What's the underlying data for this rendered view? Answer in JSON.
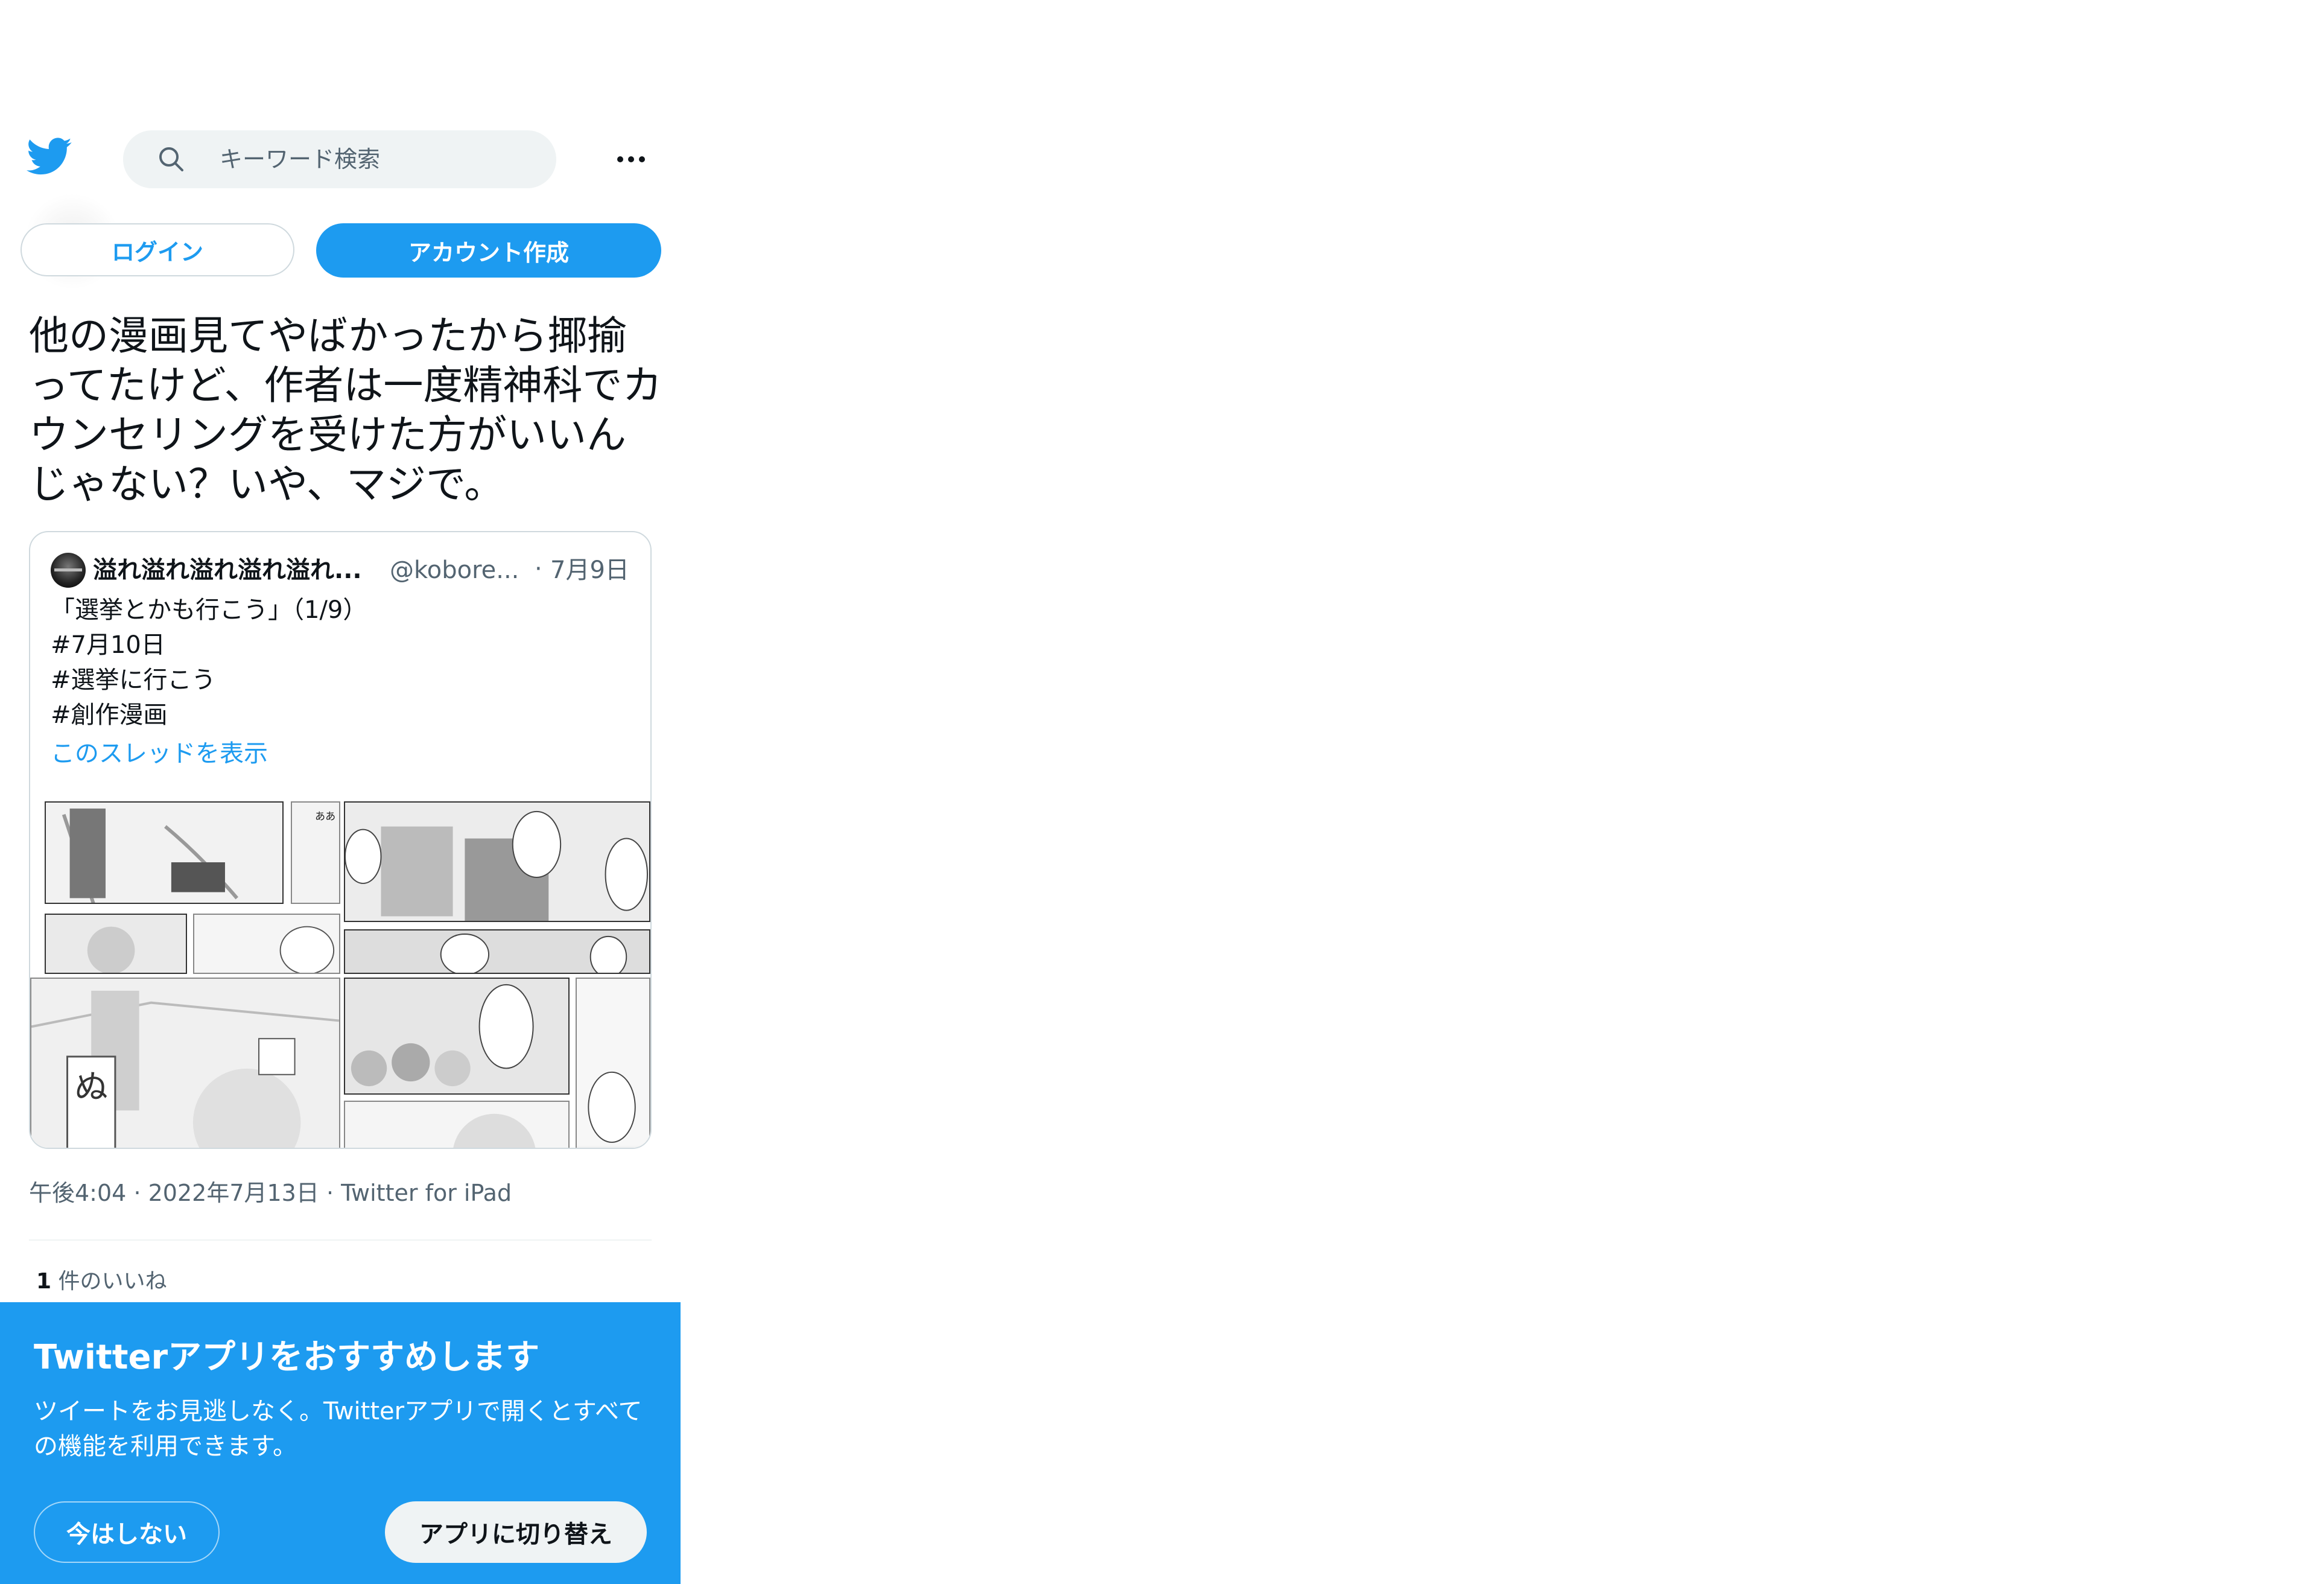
{
  "header": {
    "logo_icon": "twitter-bird-icon",
    "search_placeholder": "キーワード検索",
    "more_icon": "more-dots-icon"
  },
  "auth": {
    "login_label": "ログイン",
    "signup_label": "アカウント作成"
  },
  "tweet": {
    "text": "他の漫画見てやばかったから揶揄ってたけど、作者は一度精神科でカウンセリングを受けた方がいいんじゃない？いや、マジで。",
    "time": "午後4:04",
    "date": "2022年7月13日",
    "source": "Twitter for iPad",
    "likes_count": "1",
    "likes_label": "件のいいね"
  },
  "quoted_tweet": {
    "author_name": "溢れ溢れ溢れ溢れ溢れ...",
    "author_handle": "@kobore...",
    "date": "7月9日",
    "lines": [
      "「選挙とかも行こう」（1/9）",
      "#7月10日",
      "#選挙に行こう",
      "#創作漫画"
    ],
    "thread_link": "このスレッドを表示",
    "media_images": [
      "manga-page-1",
      "manga-page-2",
      "manga-page-3",
      "manga-page-4"
    ]
  },
  "app_banner": {
    "title": "Twitterアプリをおすすめします",
    "description": "ツイートをお見逃しなく。Twitterアプリで開くとすべての機能を利用できます。",
    "not_now_label": "今はしない",
    "switch_label": "アプリに切り替え"
  },
  "colors": {
    "brand_blue": "#1d9bf0",
    "text_primary": "#0f1419",
    "text_secondary": "#536471",
    "border": "#cfd9de",
    "search_bg": "#eff3f4"
  }
}
